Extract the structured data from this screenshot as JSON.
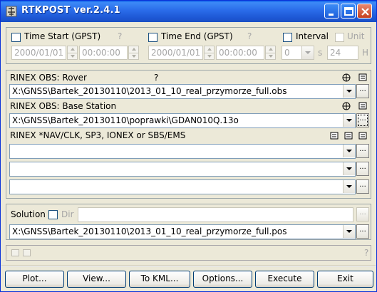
{
  "window": {
    "title": "RTKPOST ver.2.4.1"
  },
  "time": {
    "start_label": "Time Start (GPST)",
    "start_help": "?",
    "start_date": "2000/01/01",
    "start_time": "00:00:00",
    "end_label": "Time End (GPST)",
    "end_help": "?",
    "end_date": "2000/01/01",
    "end_time": "00:00:00",
    "interval_label": "Interval",
    "interval_value": "0",
    "interval_unit": "s",
    "unit_label": "Unit",
    "unit_value": "24",
    "unit_suffix": "H"
  },
  "inputs": {
    "rover_label": "RINEX OBS: Rover",
    "rover_help": "?",
    "rover_path": "X:\\GNSS\\Bartek_20130110\\2013_01_10_real_przymorze_full.obs",
    "base_label": "RINEX OBS: Base Station",
    "base_path": "X:\\GNSS\\Bartek_20130110\\poprawki\\GDAN010Q.13o",
    "nav_label": "RINEX *NAV/CLK, SP3, IONEX or SBS/EMS",
    "nav1": "",
    "nav2": "",
    "nav3": ""
  },
  "output": {
    "solution_label": "Solution",
    "dir_label": "Dir",
    "dir_value": "",
    "solution_path": "X:\\GNSS\\Bartek_20130110\\2013_01_10_real_przymorze_full.pos"
  },
  "status": {
    "help": "?"
  },
  "buttons": {
    "plot": "Plot...",
    "view": "View...",
    "kml": "To KML...",
    "options": "Options...",
    "execute": "Execute",
    "exit": "Exit"
  },
  "colors": {
    "title_bar": "#2a6ce9",
    "face": "#ece9d8",
    "border": "#7f9db9"
  }
}
